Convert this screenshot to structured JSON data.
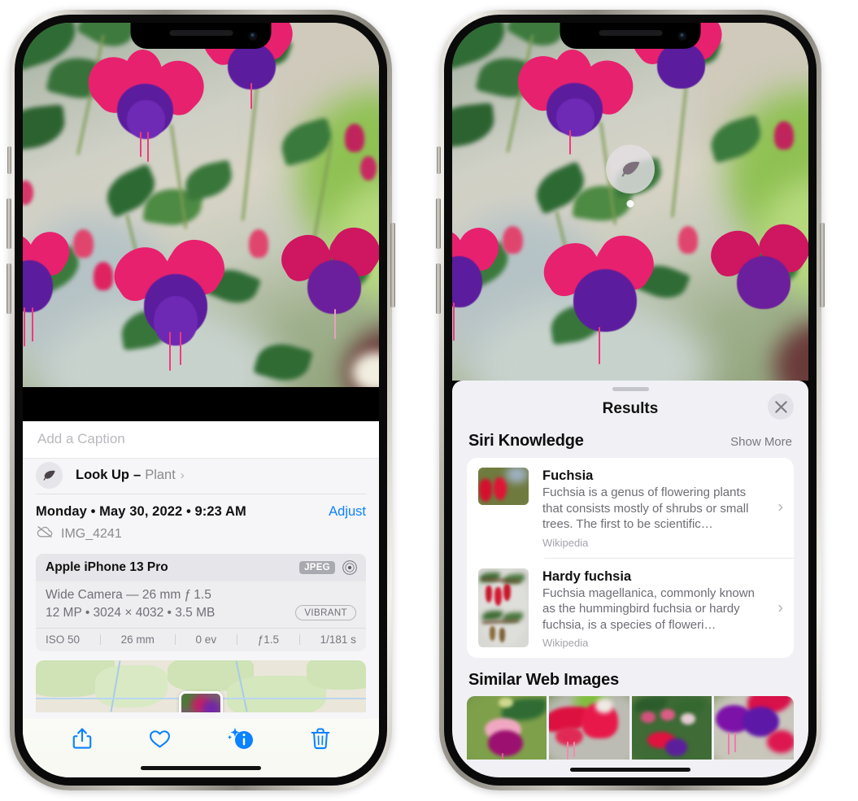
{
  "left_phone": {
    "caption": {
      "placeholder": "Add a Caption"
    },
    "lookup": {
      "title": "Look Up",
      "dash": "–",
      "subject": "Plant",
      "chevron": "›",
      "icon": "leaf-icon"
    },
    "date_row": {
      "date": "Monday • May 30, 2022 • 9:23 AM",
      "adjust_label": "Adjust"
    },
    "file_row": {
      "icon": "icloud-slash-icon",
      "filename": "IMG_4241"
    },
    "camera_card": {
      "device": "Apple iPhone 13 Pro",
      "format_badge": "JPEG",
      "aperture_icon": "aperture-icon",
      "lens_line": "Wide Camera — 26 mm ƒ 1.5",
      "size_line": "12 MP • 3024 × 4032 • 3.5 MB",
      "style_badge": "VIBRANT",
      "exif": [
        "ISO 50",
        "26 mm",
        "0 ev",
        "ƒ1.5",
        "1/181 s"
      ]
    },
    "toolbar": [
      {
        "name": "share-icon",
        "label": "Share"
      },
      {
        "name": "heart-icon",
        "label": "Favorite"
      },
      {
        "name": "info-sparkle-icon",
        "label": "Info"
      },
      {
        "name": "trash-icon",
        "label": "Delete"
      }
    ]
  },
  "right_phone": {
    "leaf_badge": {
      "icon": "leaf-icon"
    },
    "sheet": {
      "title": "Results",
      "close_icon": "close-icon",
      "grabber": "drag-handle"
    },
    "siri_knowledge": {
      "title": "Siri Knowledge",
      "show_more": "Show More",
      "results": [
        {
          "title": "Fuchsia",
          "description": "Fuchsia is a genus of flowering plants that consists mostly of shrubs or small trees. The first to be scientific…",
          "source": "Wikipedia",
          "chevron": "›"
        },
        {
          "title": "Hardy fuchsia",
          "description": "Fuchsia magellanica, commonly known as the hummingbird fuchsia or hardy fuchsia, is a species of floweri…",
          "source": "Wikipedia",
          "chevron": "›"
        }
      ]
    },
    "similar_web_images": {
      "title": "Similar Web Images",
      "thumbnails": [
        "web-image-1",
        "web-image-2",
        "web-image-3",
        "web-image-4"
      ]
    }
  },
  "colors": {
    "accent_blue": "#0b82ff",
    "sheet_bg": "#f1f1f5",
    "card_bg": "#ffffff",
    "muted_text": "#6d6d74"
  }
}
